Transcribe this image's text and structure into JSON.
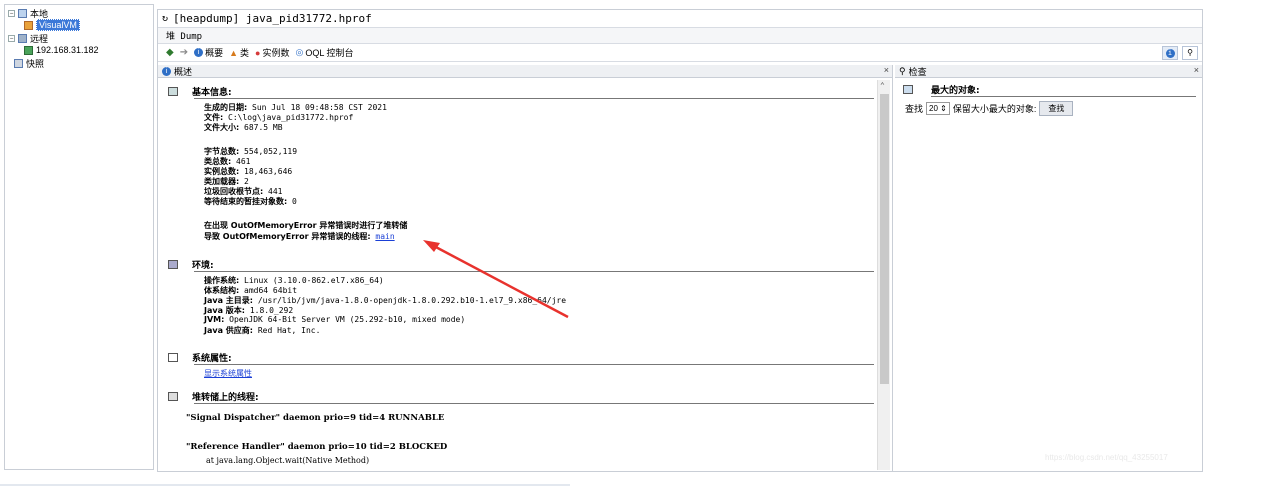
{
  "tree": {
    "local": "本地",
    "visualvm": "VisualVM",
    "remote": "远程",
    "remote_host": "192.168.31.182",
    "snapshots": "快照"
  },
  "window": {
    "title": "[heapdump] java_pid31772.hprof",
    "subtab": "堆 Dump"
  },
  "toolbar": {
    "overview": "概要",
    "classes": "类",
    "instances": "实例数",
    "oql": "OQL 控制台"
  },
  "overview_panel": {
    "header": "概述",
    "basic_info": {
      "title": "基本信息:",
      "date_label": "生成的日期:",
      "date": "Sun Jul 18 09:48:58 CST 2021",
      "file_label": "文件:",
      "file": "C:\\log\\java_pid31772.hprof",
      "size_label": "文件大小:",
      "size": "687.5 MB",
      "bytes_label": "字节总数:",
      "bytes": "554,052,119",
      "classes_label": "类总数:",
      "classes": "461",
      "instances_label": "实例总数:",
      "instances": "18,463,646",
      "classloaders_label": "类加载器:",
      "classloaders": "2",
      "gcroots_label": "垃圾回收根节点:",
      "gcroots": "441",
      "pending_label": "等待结束的暂挂对象数:",
      "pending": "0",
      "oom_line": "在出现 OutOfMemoryError 异常错误时进行了堆转储",
      "oom_thread_label": "导致 OutOfMemoryError 异常错误的线程:",
      "oom_thread": "main"
    },
    "env": {
      "title": "环境:",
      "os_label": "操作系统:",
      "os": "Linux (3.10.0-862.el7.x86_64)",
      "arch_label": "体系结构:",
      "arch": "amd64 64bit",
      "home_label": "Java 主目录:",
      "home": "/usr/lib/jvm/java-1.8.0-openjdk-1.8.0.292.b10-1.el7_9.x86_64/jre",
      "version_label": "Java 版本:",
      "version": "1.8.0_292",
      "jvm_label": "JVM:",
      "jvm": "OpenJDK 64-Bit Server VM (25.292-b10, mixed mode)",
      "vendor_label": "Java 供应商:",
      "vendor": "Red Hat, Inc."
    },
    "sysprops": {
      "title": "系统属性:",
      "link": "显示系统属性"
    },
    "threads": {
      "title": "堆转储上的线程:",
      "t1": "\"Signal Dispatcher\" daemon prio=9 tid=4 RUNNABLE",
      "t2": "\"Reference Handler\" daemon prio=10 tid=2 BLOCKED",
      "t2_frame": "at java.lang.Object.wait(Native Method)"
    }
  },
  "inspect_panel": {
    "header": "检查",
    "section": "最大的对象:",
    "find_label": "查找",
    "count": "20",
    "keep_label": "保留大小最大的对象:",
    "find_button": "查找"
  },
  "watermark": "https://blog.csdn.net/qq_43255017",
  "colors": {
    "accent": "#3b78d8",
    "link": "#1a3fd6",
    "arrow": "#e8322d"
  }
}
